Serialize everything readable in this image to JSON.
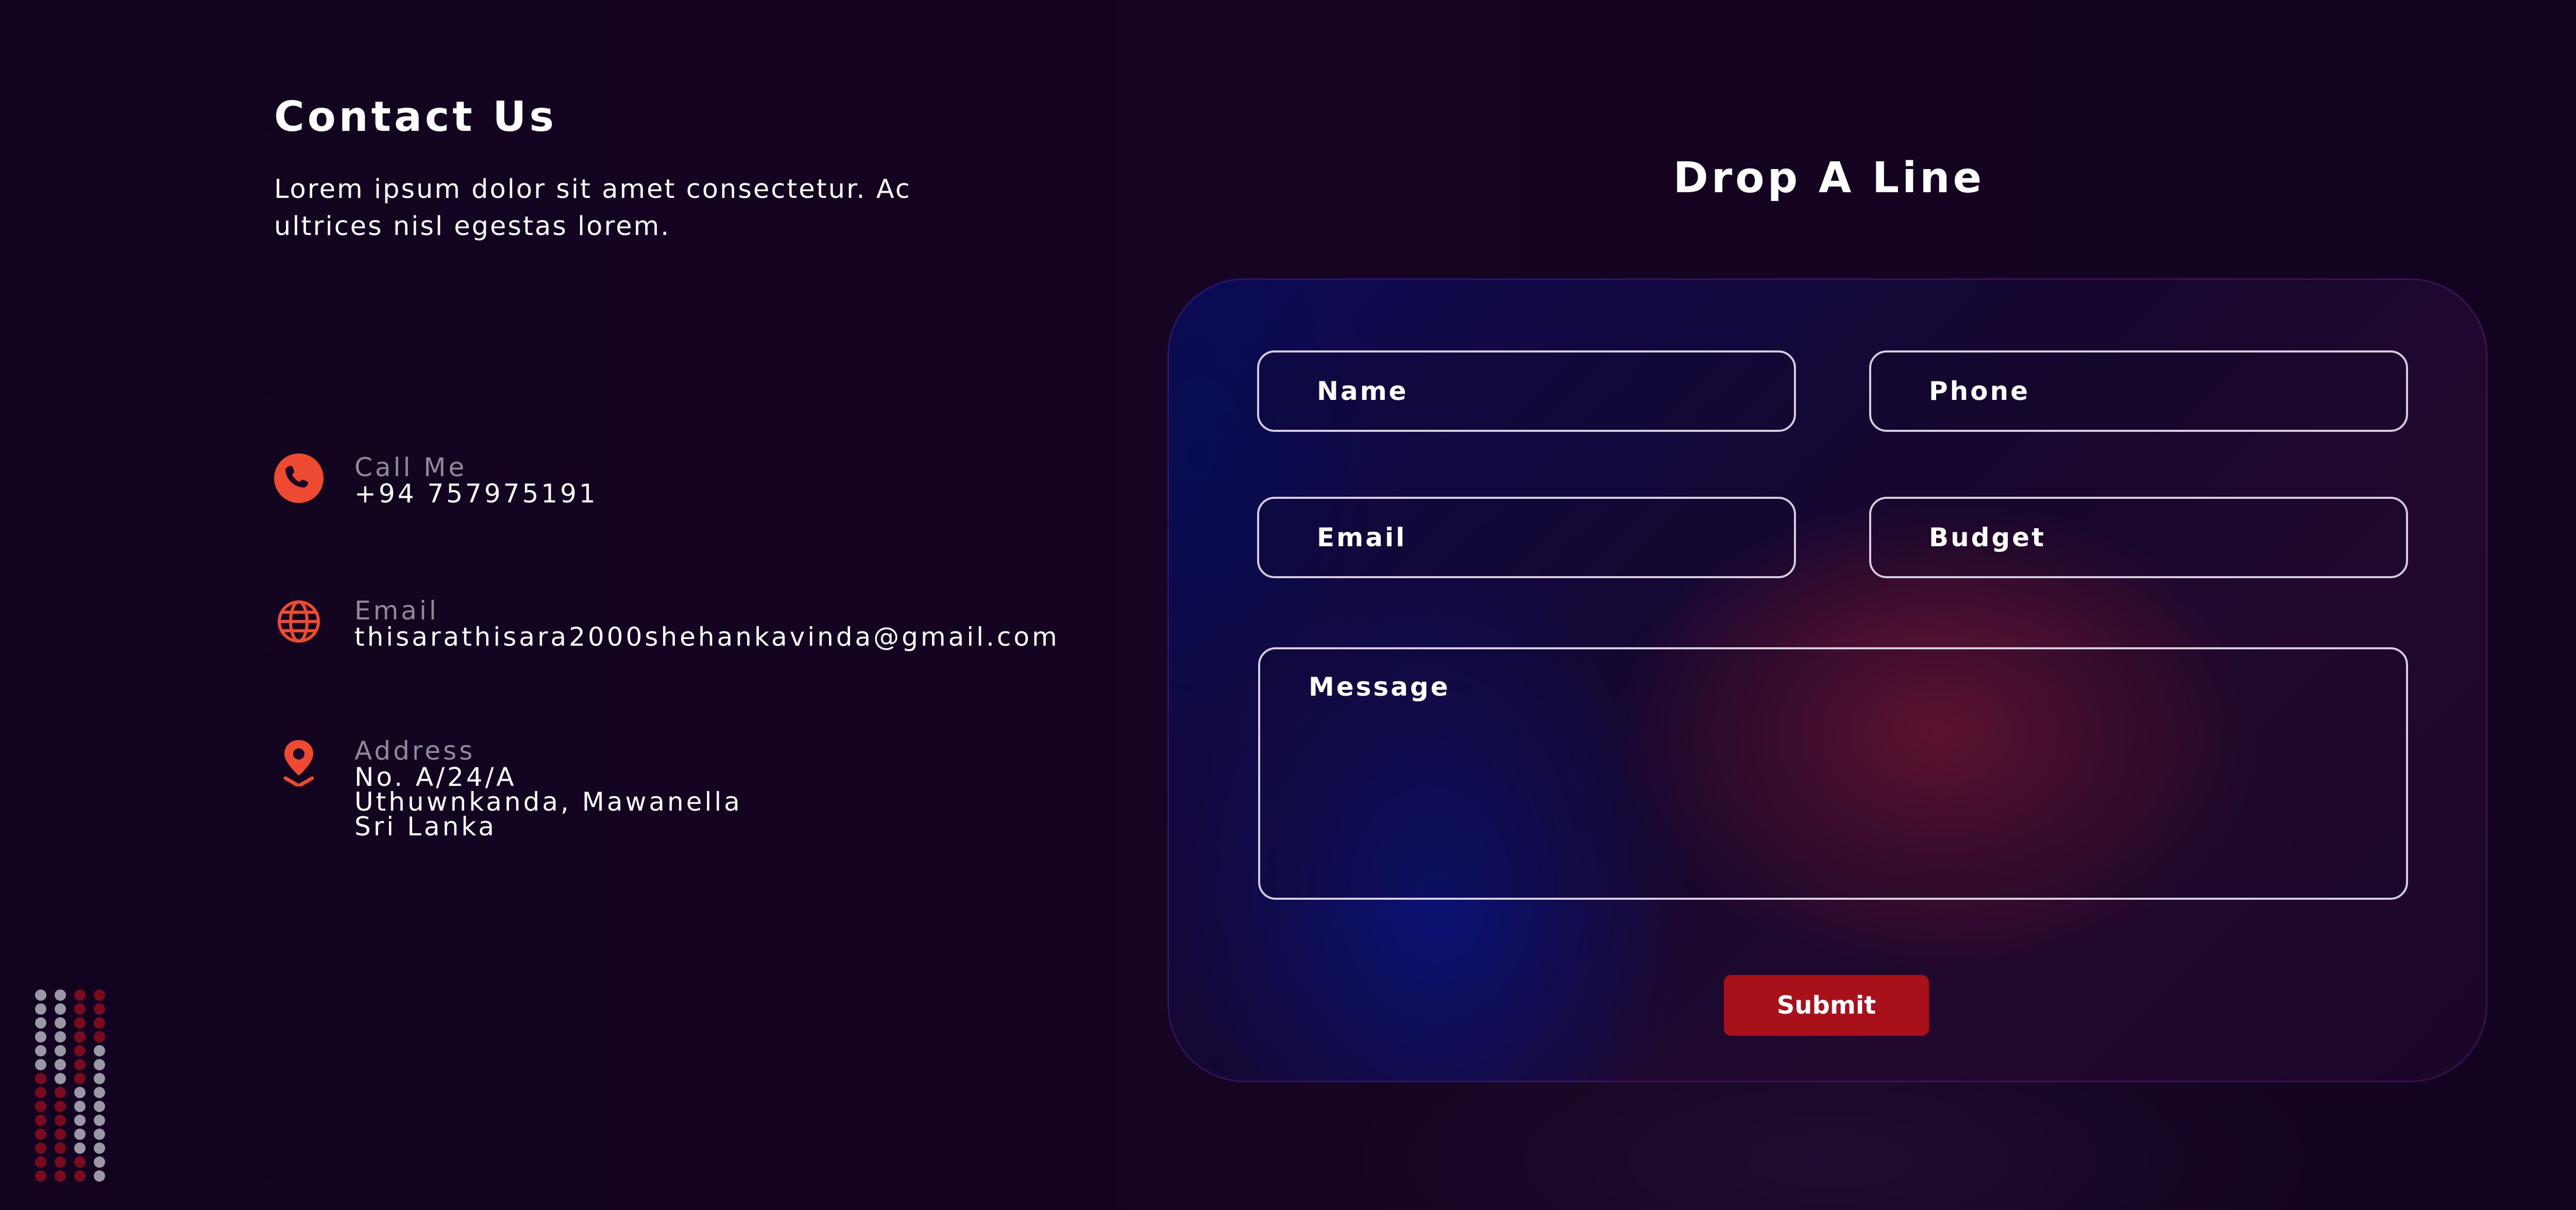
{
  "contact": {
    "title": "Contact Us",
    "description": "Lorem ipsum dolor sit amet consectetur. Ac ultrices nisl egestas lorem."
  },
  "info": {
    "call": {
      "label": "Call Me",
      "value": "+94 757975191",
      "icon": "phone-icon"
    },
    "email": {
      "label": "Email",
      "value": "thisarathisara2000shehankavinda@gmail.com",
      "icon": "globe-icon"
    },
    "address": {
      "label": "Address",
      "line1": "No. A/24/A",
      "line2": "Uthuwnkanda, Mawanella",
      "line3": "Sri Lanka",
      "icon": "location-pin-icon"
    }
  },
  "form": {
    "title": "Drop A Line",
    "name_placeholder": "Name",
    "phone_placeholder": "Phone",
    "email_placeholder": "Email",
    "budget_placeholder": "Budget",
    "message_placeholder": "Message",
    "submit_label": "Submit"
  },
  "colors": {
    "background": "#130420",
    "accent_icon": "#ee4a32",
    "button": "#a8101a",
    "muted_label": "#8f8a99",
    "dot_grey": "#9a98a6",
    "dot_red": "#7a0a1e"
  }
}
